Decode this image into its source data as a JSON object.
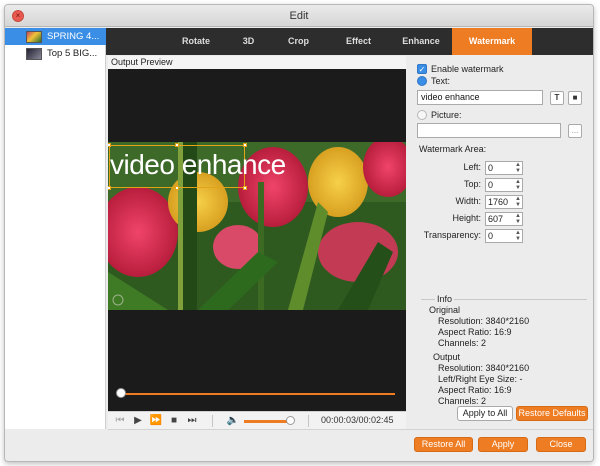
{
  "window": {
    "title": "Edit"
  },
  "files": [
    {
      "label": "SPRING 4...",
      "selected": true
    },
    {
      "label": "Top 5 BIG...",
      "selected": false
    }
  ],
  "tabs": [
    {
      "label": "Rotate",
      "active": false
    },
    {
      "label": "3D",
      "active": false
    },
    {
      "label": "Crop",
      "active": false
    },
    {
      "label": "Effect",
      "active": false
    },
    {
      "label": "Enhance",
      "active": false
    },
    {
      "label": "Watermark",
      "active": true
    }
  ],
  "preview": {
    "header": "Output Preview",
    "watermark_text": "video enhance",
    "progress": 0.0,
    "time": "00:00:03/00:02:45",
    "volume": 0.9
  },
  "watermark": {
    "enable_label": "Enable watermark",
    "enable_checked": true,
    "text_label": "Text:",
    "text_selected": true,
    "text_value": "video enhance",
    "picture_label": "Picture:",
    "picture_selected": false,
    "picture_value": "",
    "browse_label": "...",
    "area_label": "Watermark Area:",
    "fields": [
      {
        "label": "Left:",
        "value": "0"
      },
      {
        "label": "Top:",
        "value": "0"
      },
      {
        "label": "Width:",
        "value": "1760"
      },
      {
        "label": "Height:",
        "value": "607"
      },
      {
        "label": "Transparency:",
        "value": "0"
      }
    ]
  },
  "info": {
    "title": "Info",
    "original_label": "Original",
    "original": [
      "Resolution: 3840*2160",
      "Aspect Ratio: 16:9",
      "Channels: 2"
    ],
    "output_label": "Output",
    "output": [
      "Resolution: 3840*2160",
      "Left/Right Eye Size: -",
      "Aspect Ratio: 16:9",
      "Channels: 2"
    ]
  },
  "buttons": {
    "apply_to_all": "Apply to All",
    "restore_defaults": "Restore Defaults",
    "restore_all": "Restore All",
    "apply": "Apply",
    "close": "Close"
  },
  "colors": {
    "accent": "#ee7c22",
    "selection": "#3a8ee6",
    "tabbar": "#2d2d2d"
  },
  "icons": {
    "font_button": "T",
    "color_button": "■",
    "volume": "🔈"
  }
}
